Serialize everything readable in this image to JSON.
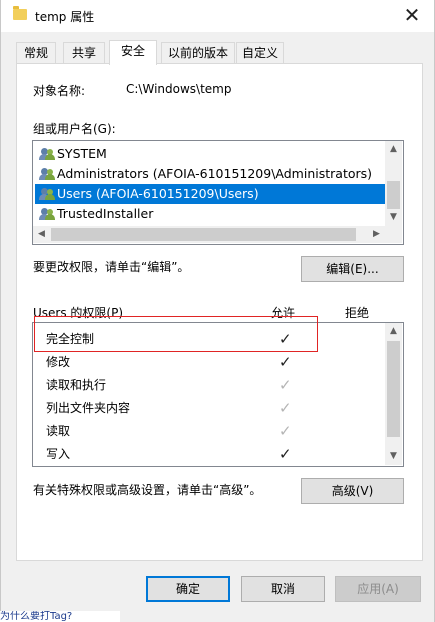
{
  "window": {
    "title": "temp 属性",
    "close_glyph": "✕"
  },
  "tabs": [
    "常规",
    "共享",
    "安全",
    "以前的版本",
    "自定义"
  ],
  "active_tab_index": 2,
  "object": {
    "label": "对象名称:",
    "value": "C:\\Windows\\temp"
  },
  "groups": {
    "label": "组或用户名(G):",
    "items": [
      {
        "name": "SYSTEM",
        "selected": false
      },
      {
        "name": "Administrators (AFOIA-610151209\\Administrators)",
        "selected": false
      },
      {
        "name": "Users (AFOIA-610151209\\Users)",
        "selected": true
      },
      {
        "name": "TrustedInstaller",
        "selected": false
      }
    ]
  },
  "edit_hint": "要更改权限，请单击“编辑”。",
  "edit_button": "编辑(E)...",
  "permissions": {
    "header": "Users 的权限(P)",
    "allow_label": "允许",
    "deny_label": "拒绝",
    "check_glyph": "✓",
    "rows": [
      {
        "name": "完全控制",
        "allow": "explicit"
      },
      {
        "name": "修改",
        "allow": "explicit"
      },
      {
        "name": "读取和执行",
        "allow": "inherited"
      },
      {
        "name": "列出文件夹内容",
        "allow": "inherited"
      },
      {
        "name": "读取",
        "allow": "inherited"
      },
      {
        "name": "写入",
        "allow": "explicit"
      }
    ]
  },
  "advanced_hint": "有关特殊权限或高级设置，请单击“高级”。",
  "advanced_button": "高级(V)",
  "footer": {
    "ok": "确定",
    "cancel": "取消",
    "apply": "应用(A)"
  },
  "background_text": "为什么要打Tag?",
  "colors": {
    "selection": "#0078d7",
    "highlight_box": "#e02424"
  }
}
